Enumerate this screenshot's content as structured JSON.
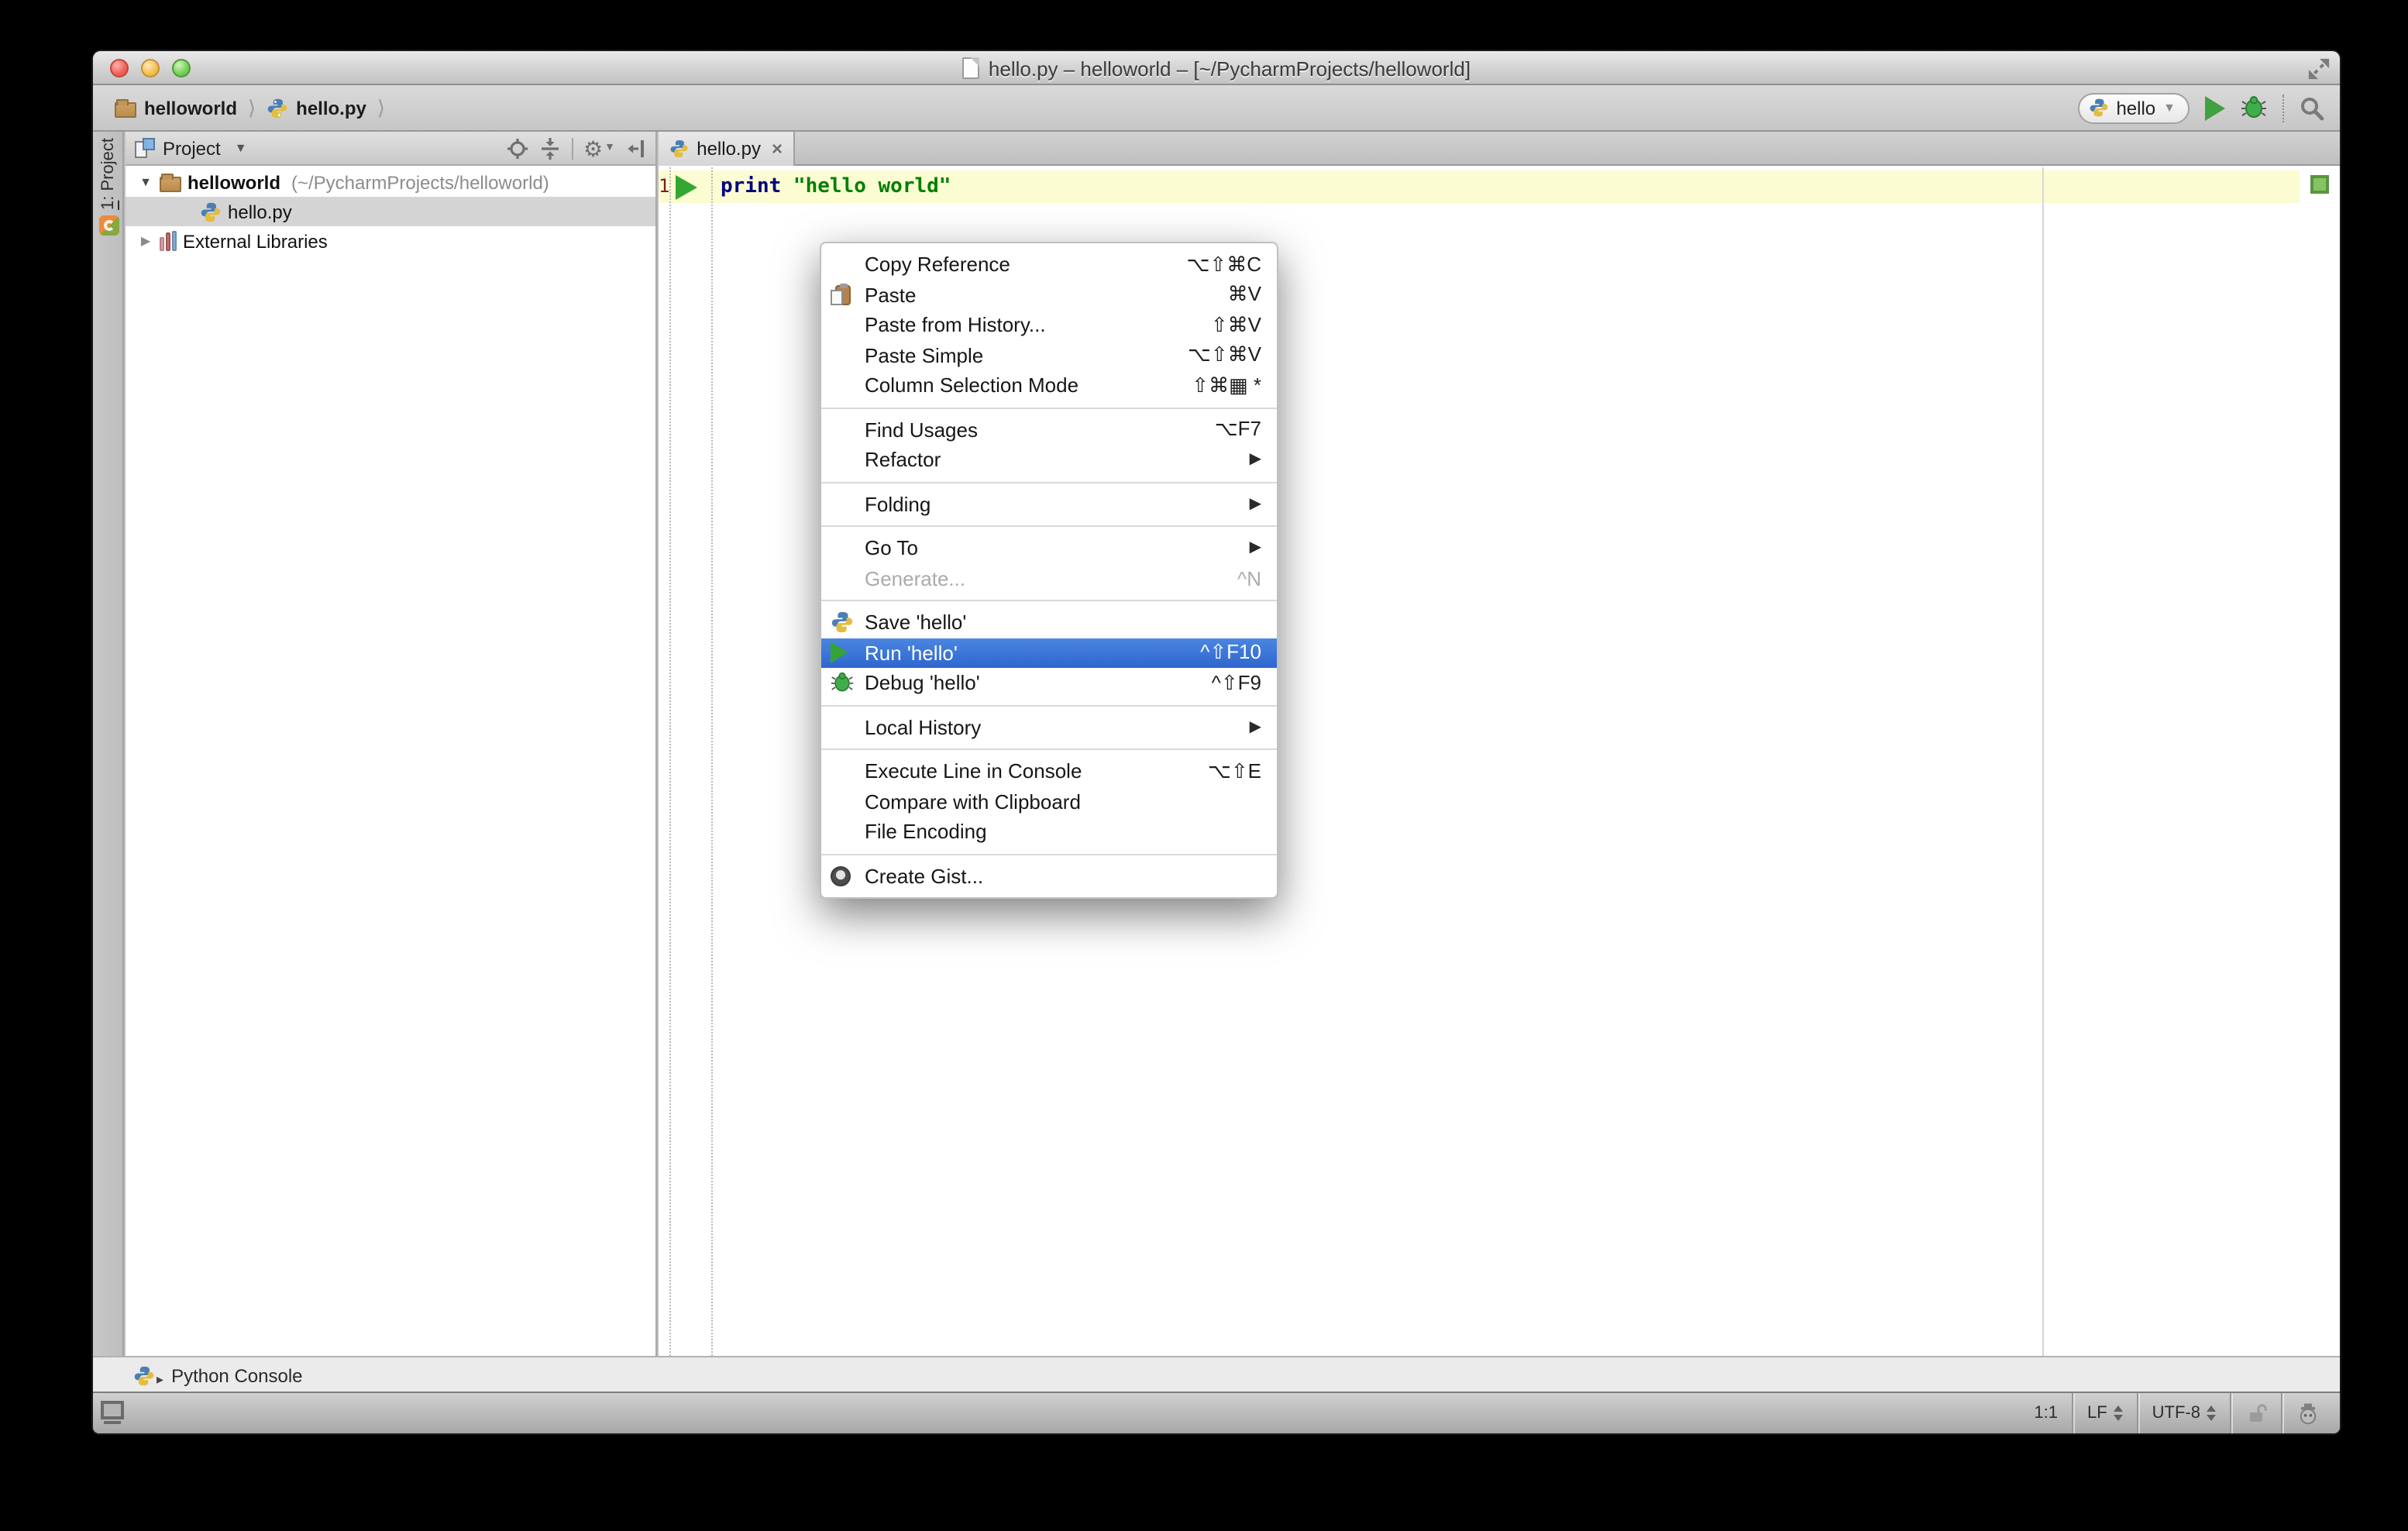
{
  "window": {
    "title": "hello.py – helloworld – [~/PycharmProjects/helloworld]"
  },
  "breadcrumb": {
    "project": "helloworld",
    "file": "hello.py"
  },
  "run_toolbar": {
    "config_name": "hello"
  },
  "tool_stripe": {
    "mnemonic": "1",
    "label": ": Project"
  },
  "project_panel": {
    "title": "Project",
    "tree": {
      "root_name": "helloworld",
      "root_path": "(~/PycharmProjects/helloworld)",
      "file": "hello.py",
      "external_libraries": "External Libraries"
    }
  },
  "editor": {
    "tab_title": "hello.py",
    "close_glyph": "×",
    "line_number": "1",
    "code_keyword": "print",
    "code_string": " \"hello world\""
  },
  "context_menu": {
    "items": [
      {
        "label": "Copy Reference",
        "shortcut": "⌥⇧⌘C"
      },
      {
        "label": "Paste",
        "shortcut": "⌘V",
        "icon": "paste"
      },
      {
        "label": "Paste from History...",
        "shortcut": "⇧⌘V"
      },
      {
        "label": "Paste Simple",
        "shortcut": "⌥⇧⌘V"
      },
      {
        "label": "Column Selection Mode",
        "shortcut": "⇧⌘▦ *"
      },
      {
        "label": "Find Usages",
        "shortcut": "⌥F7"
      },
      {
        "label": "Refactor",
        "submenu": true
      },
      {
        "label": "Folding",
        "submenu": true
      },
      {
        "label": "Go To",
        "submenu": true
      },
      {
        "label": "Generate...",
        "shortcut": "^N",
        "disabled": true
      },
      {
        "label": "Save 'hello'",
        "icon": "python"
      },
      {
        "label": "Run 'hello'",
        "shortcut": "^⇧F10",
        "icon": "run",
        "highlighted": true
      },
      {
        "label": "Debug 'hello'",
        "shortcut": "^⇧F9",
        "icon": "debug"
      },
      {
        "label": "Local History",
        "submenu": true
      },
      {
        "label": "Execute Line in Console",
        "shortcut": "⌥⇧E"
      },
      {
        "label": "Compare with Clipboard"
      },
      {
        "label": "File Encoding"
      },
      {
        "label": "Create Gist...",
        "icon": "github"
      }
    ]
  },
  "bottom_bar": {
    "python_console": "Python Console"
  },
  "status_bar": {
    "caret_position": "1:1",
    "line_separator": "LF",
    "encoding": "UTF-8"
  },
  "icons": {
    "submenu_arrow": "▶",
    "chevron": "⟩",
    "combo_arrow": "▼",
    "gear": "⚙",
    "tree_expanded": "▼",
    "tree_collapsed": "▶",
    "console_arrow": "▸"
  },
  "colors": {
    "menu_highlight": "#3875d7",
    "run_green": "#3fa142",
    "current_line": "#fcfcd2",
    "tree_selection": "#d4d4d4"
  }
}
